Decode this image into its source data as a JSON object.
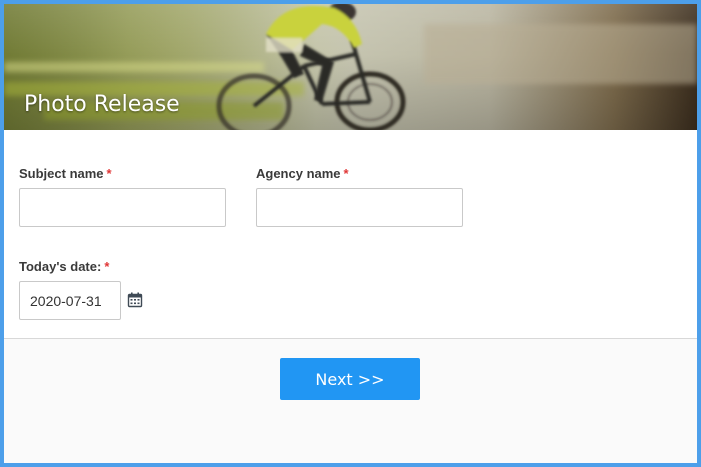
{
  "form": {
    "title": "Photo Release",
    "fields": {
      "subject_name": {
        "label": "Subject name",
        "required_mark": "*",
        "value": ""
      },
      "agency_name": {
        "label": "Agency name",
        "required_mark": "*",
        "value": ""
      },
      "todays_date": {
        "label": "Today's date:",
        "required_mark": "*",
        "value": "2020-07-31"
      }
    },
    "next_button_label": "Next >>"
  },
  "colors": {
    "frame_border": "#4d9fea",
    "button_bg": "#2196f3",
    "required": "#e03535"
  },
  "icons": {
    "header_image": "cyclist-photo",
    "date_picker": "calendar-icon"
  }
}
